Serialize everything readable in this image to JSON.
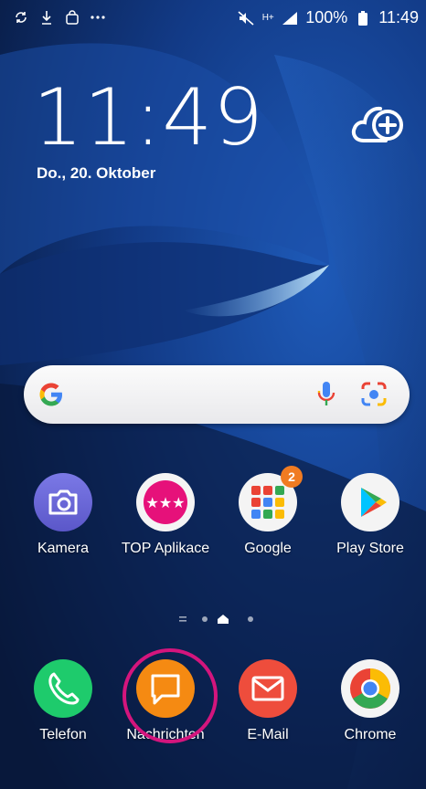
{
  "status_bar": {
    "left_icons": [
      "sync-icon",
      "download-icon",
      "shopping-bag-icon",
      "more-icon"
    ],
    "right_icons": [
      "mute-icon",
      "signal-icon"
    ],
    "network_type": "H+",
    "battery": "100%",
    "time": "11:49"
  },
  "lockclock": {
    "time": "11:49",
    "date": "Do., 20. Oktober"
  },
  "cloud_button": {
    "icon": "cloud-add-icon"
  },
  "search_bar": {
    "logo": "google-g-icon",
    "mic": "microphone-icon",
    "lens": "google-lens-icon"
  },
  "apps": [
    {
      "label": "Kamera",
      "icon": "camera-icon",
      "color": "#6f6ad6"
    },
    {
      "label": "TOP Aplikace",
      "icon": "stars-icon",
      "color": "#e6117a"
    },
    {
      "label": "Google",
      "icon": "folder-icon",
      "badge": "2"
    },
    {
      "label": "Play Store",
      "icon": "play-store-icon"
    }
  ],
  "page_indicator": {
    "active_page": "home"
  },
  "dock": [
    {
      "label": "Telefon",
      "icon": "phone-icon",
      "color": "#1ecb6c"
    },
    {
      "label": "Nachrichten",
      "icon": "message-icon",
      "color": "#f58a12"
    },
    {
      "label": "E-Mail",
      "icon": "mail-icon",
      "color": "#ee4d3c"
    },
    {
      "label": "Chrome",
      "icon": "chrome-icon"
    }
  ]
}
